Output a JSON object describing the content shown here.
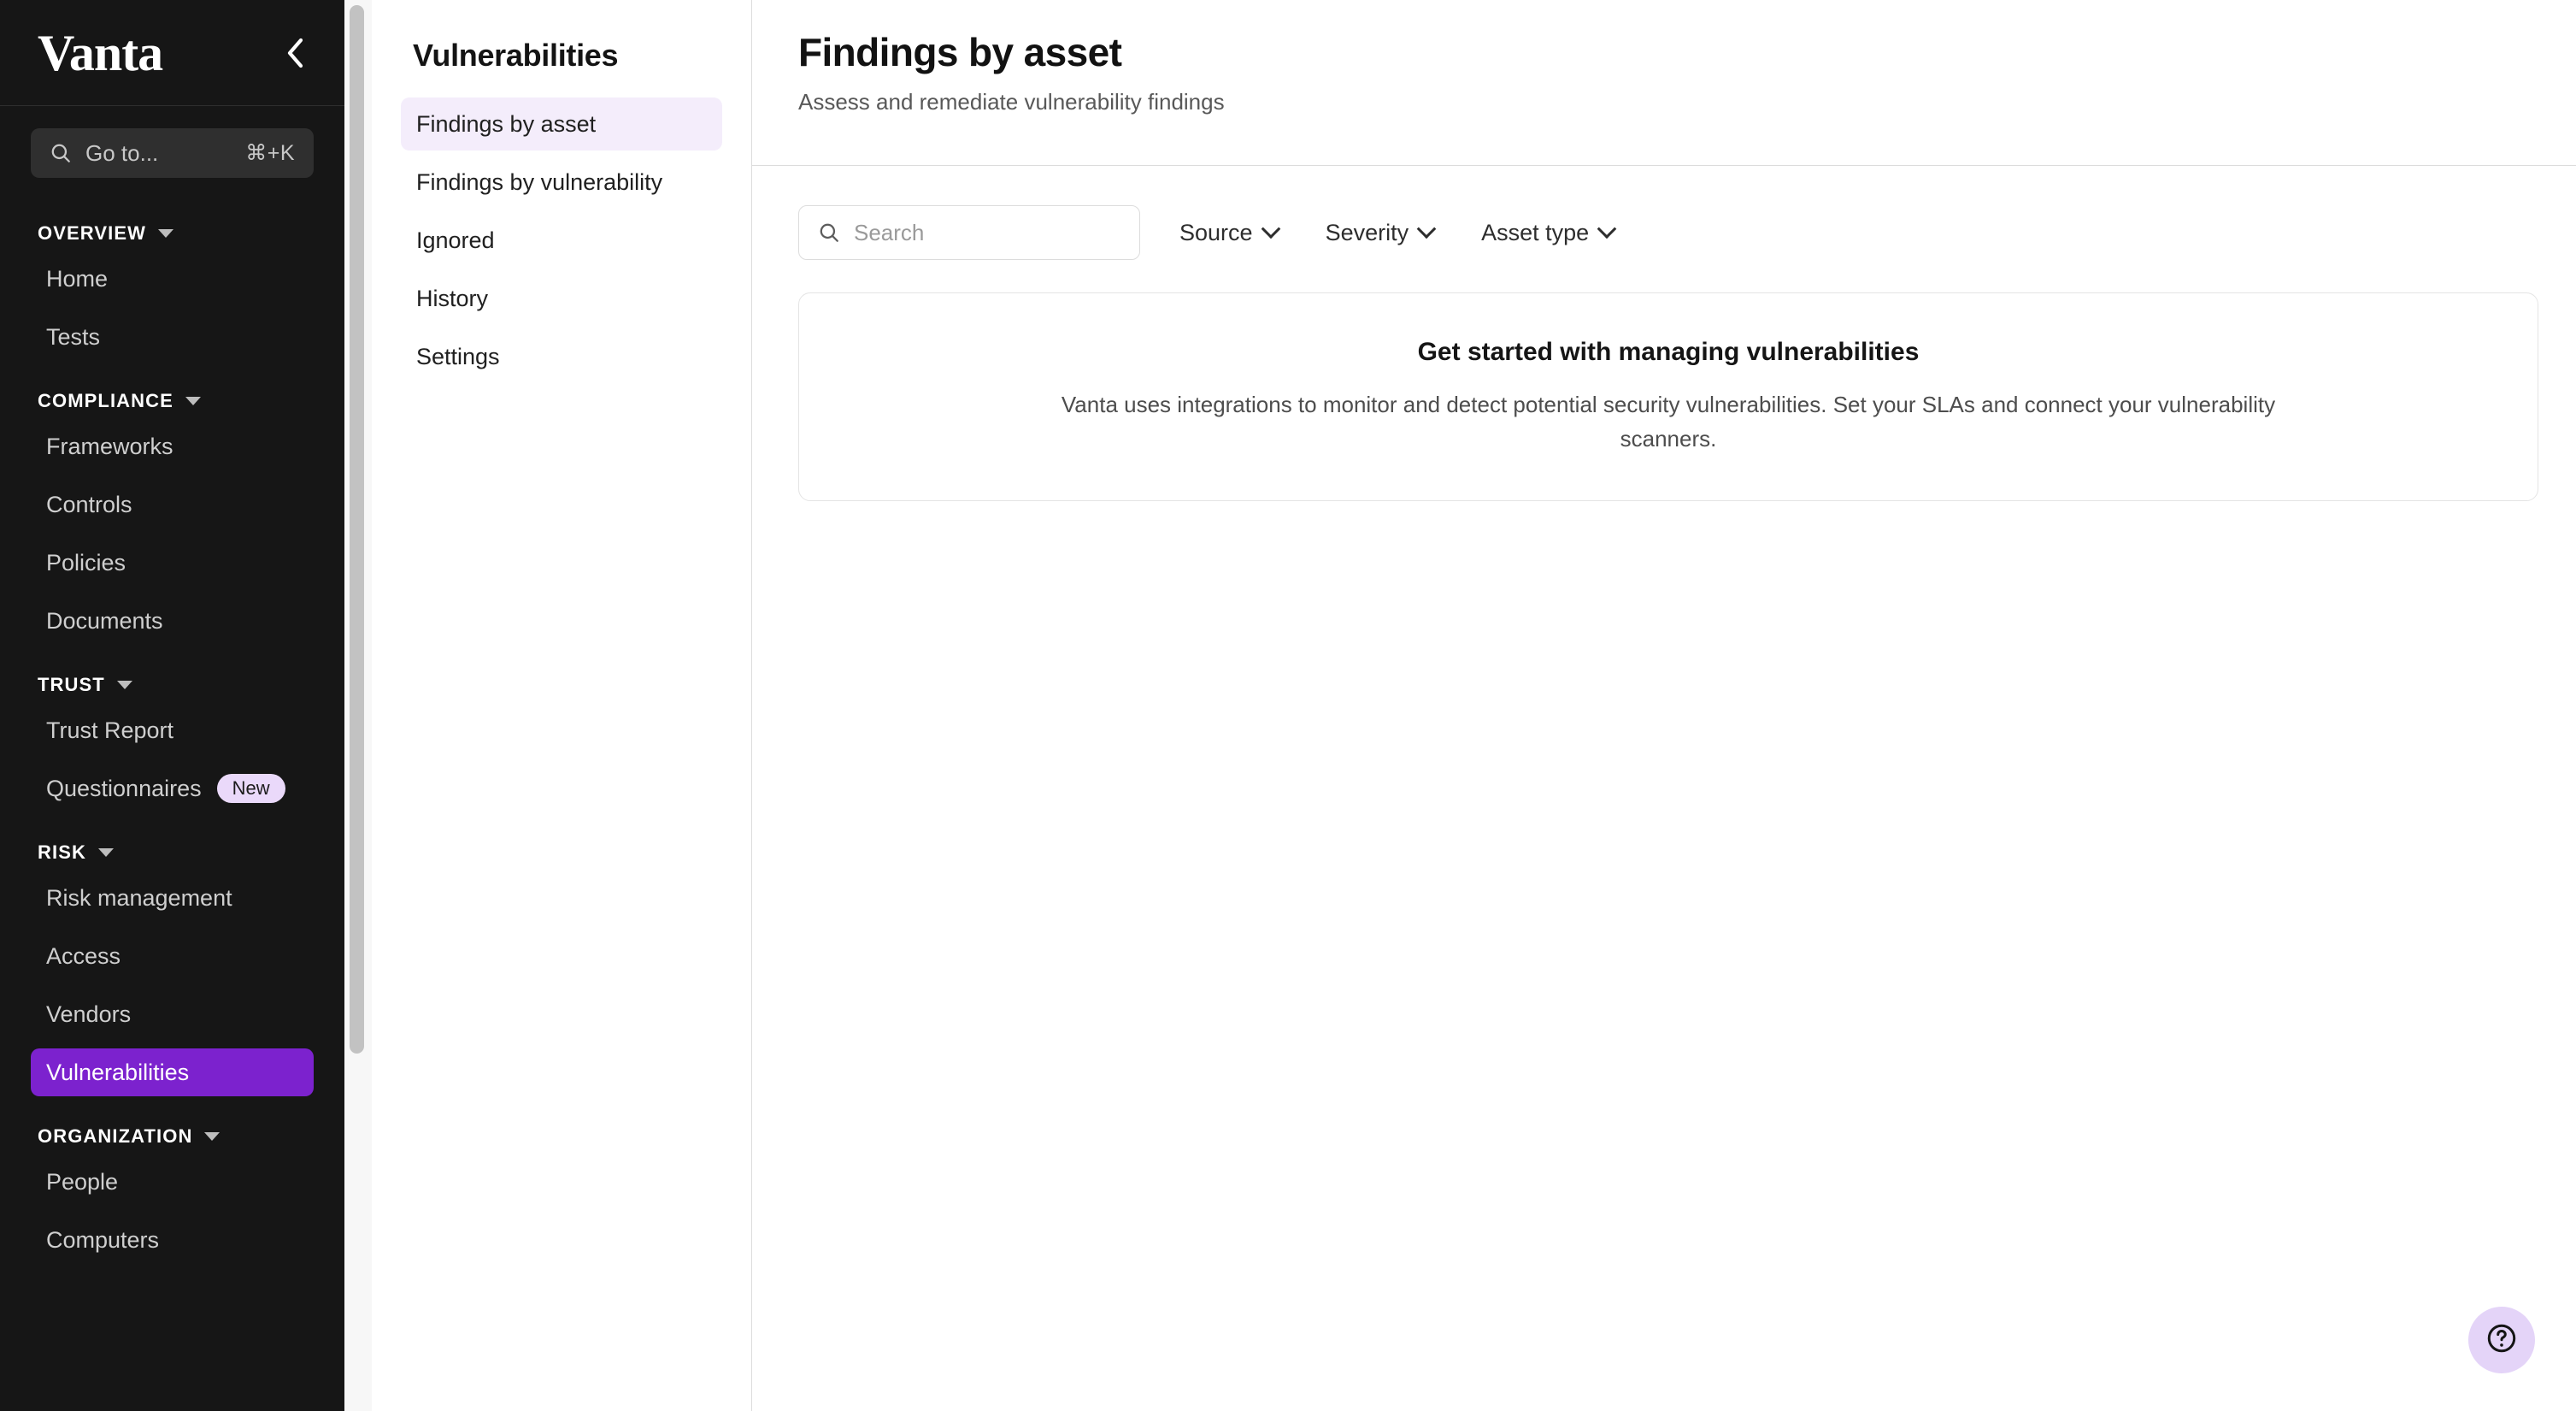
{
  "brand": {
    "name": "Vanta",
    "collapse_icon": "chevron-left-icon"
  },
  "sidebar": {
    "search": {
      "icon": "search-icon",
      "placeholder": "Go to...",
      "shortcut": "⌘+K"
    },
    "groups": [
      {
        "label": "OVERVIEW",
        "items": [
          {
            "label": "Home",
            "active": false
          },
          {
            "label": "Tests",
            "active": false
          }
        ]
      },
      {
        "label": "COMPLIANCE",
        "items": [
          {
            "label": "Frameworks",
            "active": false
          },
          {
            "label": "Controls",
            "active": false
          },
          {
            "label": "Policies",
            "active": false
          },
          {
            "label": "Documents",
            "active": false
          }
        ]
      },
      {
        "label": "TRUST",
        "items": [
          {
            "label": "Trust Report",
            "active": false
          },
          {
            "label": "Questionnaires",
            "active": false,
            "badge": "New"
          }
        ]
      },
      {
        "label": "RISK",
        "items": [
          {
            "label": "Risk management",
            "active": false
          },
          {
            "label": "Access",
            "active": false
          },
          {
            "label": "Vendors",
            "active": false
          },
          {
            "label": "Vulnerabilities",
            "active": true
          }
        ]
      },
      {
        "label": "ORGANIZATION",
        "items": [
          {
            "label": "People",
            "active": false
          },
          {
            "label": "Computers",
            "active": false
          }
        ]
      }
    ]
  },
  "subnav": {
    "title": "Vulnerabilities",
    "items": [
      {
        "label": "Findings by asset",
        "active": true
      },
      {
        "label": "Findings by vulnerability",
        "active": false
      },
      {
        "label": "Ignored",
        "active": false
      },
      {
        "label": "History",
        "active": false
      },
      {
        "label": "Settings",
        "active": false
      }
    ]
  },
  "main": {
    "title": "Findings by asset",
    "subtitle": "Assess and remediate vulnerability findings",
    "search": {
      "icon": "search-icon",
      "placeholder": "Search",
      "value": ""
    },
    "filters": [
      {
        "label": "Source"
      },
      {
        "label": "Severity"
      },
      {
        "label": "Asset type"
      }
    ],
    "empty_state": {
      "title": "Get started with managing vulnerabilities",
      "body": "Vanta uses integrations to monitor and detect potential security vulnerabilities. Set your SLAs and connect your vulnerability scanners."
    }
  },
  "help": {
    "icon": "question-circle-icon"
  },
  "colors": {
    "sidebar_bg": "#161616",
    "accent_purple": "#7c22ce",
    "badge_bg": "#ead9fa",
    "subnav_active_bg": "#f4edfb",
    "help_fab_bg": "#e4d4f8"
  }
}
